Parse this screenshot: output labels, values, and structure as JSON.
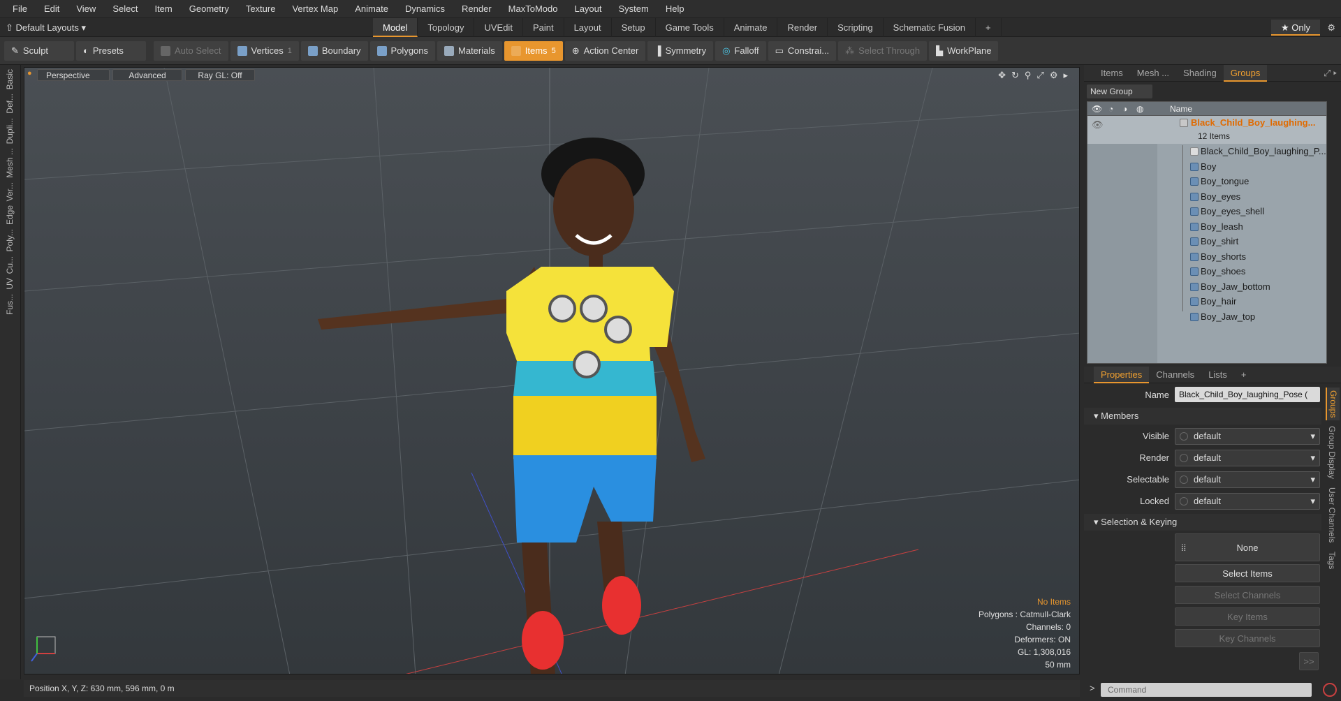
{
  "menubar": {
    "items": [
      "File",
      "Edit",
      "View",
      "Select",
      "Item",
      "Geometry",
      "Texture",
      "Vertex Map",
      "Animate",
      "Dynamics",
      "Render",
      "MaxToModo",
      "Layout",
      "System",
      "Help"
    ]
  },
  "layouts": {
    "selector": "Default Layouts ▾",
    "tabs": [
      "Model",
      "Topology",
      "UVEdit",
      "Paint",
      "Layout",
      "Setup",
      "Game Tools",
      "Animate",
      "Render",
      "Scripting",
      "Schematic Fusion"
    ],
    "only_label": "★ Only"
  },
  "toolbar": {
    "sculpt": "Sculpt",
    "presets": "Presets",
    "auto_select": "Auto Select",
    "vertices": "Vertices",
    "vertices_count": "1",
    "boundary": "Boundary",
    "polygons": "Polygons",
    "materials": "Materials",
    "items": "Items",
    "items_count": "5",
    "action_center": "Action Center",
    "symmetry": "Symmetry",
    "falloff": "Falloff",
    "constraints": "Constrai...",
    "select_through": "Select Through",
    "workplane": "WorkPlane"
  },
  "left_tabs": [
    "Basic",
    "Def...",
    "Dupli...",
    "Mesh ...",
    "Ver...",
    "Edge",
    "Poly...",
    "Cu...",
    "UV",
    "Fus..."
  ],
  "viewport": {
    "view": "Perspective",
    "shading": "Advanced",
    "raygl": "Ray GL: Off",
    "info": {
      "no_items": "No Items",
      "polygons": "Polygons : Catmull-Clark",
      "channels": "Channels: 0",
      "deformers": "Deformers: ON",
      "gl": "GL: 1,308,016",
      "focal": "50 mm"
    }
  },
  "statusbar": {
    "position": "Position X, Y, Z:  630 mm, 596 mm, 0 m"
  },
  "right_panel": {
    "tabs": [
      "Items",
      "Mesh ...",
      "Shading",
      "Groups"
    ],
    "new_group": "New Group",
    "list_header": "Name",
    "group": {
      "name": "Black_Child_Boy_laughing...",
      "count": "12 Items"
    },
    "items": [
      "Black_Child_Boy_laughing_P...",
      "Boy",
      "Boy_tongue",
      "Boy_eyes",
      "Boy_eyes_shell",
      "Boy_leash",
      "Boy_shirt",
      "Boy_shorts",
      "Boy_shoes",
      "Boy_Jaw_bottom",
      "Boy_hair",
      "Boy_Jaw_top"
    ],
    "prop_tabs": [
      "Properties",
      "Channels",
      "Lists",
      "+"
    ],
    "props": {
      "name_label": "Name",
      "name_value": "Black_Child_Boy_laughing_Pose (",
      "members": "Members",
      "visible_label": "Visible",
      "visible": "default",
      "render_label": "Render",
      "render": "default",
      "selectable_label": "Selectable",
      "selectable": "default",
      "locked_label": "Locked",
      "locked": "default",
      "selection_keying": "Selection & Keying",
      "none": "None",
      "select_items": "Select Items",
      "select_channels": "Select Channels",
      "key_items": "Key Items",
      "key_channels": "Key Channels",
      "more": ">>"
    },
    "side_tabs": [
      "Groups",
      "Group Display",
      "User Channels",
      "Tags"
    ]
  },
  "command": {
    "placeholder": "Command"
  }
}
